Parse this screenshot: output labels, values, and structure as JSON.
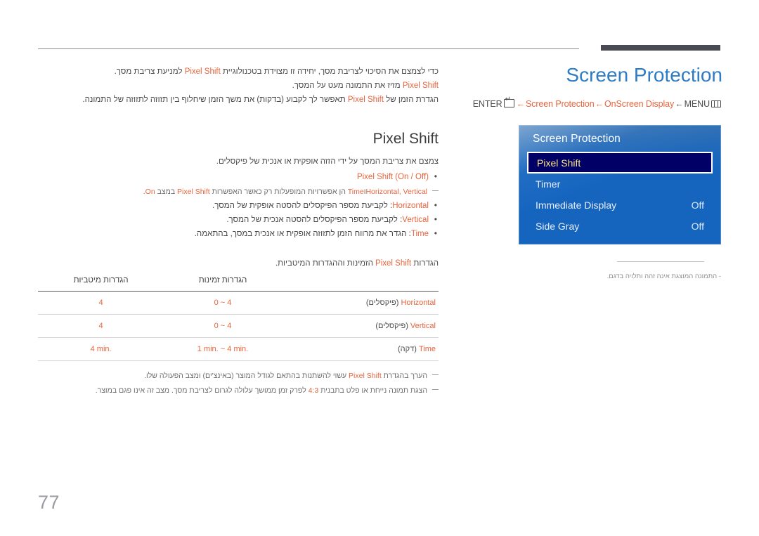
{
  "page": {
    "number": "77",
    "language": "he"
  },
  "header": {
    "title": "Screen Protection",
    "title_color": "#2d7cc4",
    "accent_color": "#e8643c"
  },
  "breadcrumb": {
    "enter_label": "ENTER",
    "enter_icon": "enter-key-icon",
    "arrow": "←",
    "items": [
      {
        "label": "Screen Protection",
        "accent": true
      },
      {
        "label": "OnScreen Display",
        "accent": true
      },
      {
        "label": "MENU",
        "accent": false
      }
    ],
    "menu_icon": "menu-key-icon"
  },
  "osd": {
    "title": "Screen Protection",
    "rows": [
      {
        "label": "Pixel Shift",
        "value": "",
        "selected": true
      },
      {
        "label": "Timer",
        "value": "",
        "selected": false
      },
      {
        "label": "Immediate Display",
        "value": "Off",
        "selected": false
      },
      {
        "label": "Side Gray",
        "value": "Off",
        "selected": false
      }
    ],
    "selected_bg": "#000066",
    "selected_text": "#ffe680",
    "panel_blue": "#1565bf"
  },
  "osd_note": {
    "dash": "-",
    "text": "התמונה המוצגת אינה זהה ותלויה בדגם."
  },
  "intro": {
    "line1_a": "כדי לצמצם את הסיכוי לצריבת מסך, יחידה זו מצוידת בטכנולוגיית ",
    "line1_hl": "Pixel Shift",
    "line1_b": " למניעת צריבת מסך.",
    "line2_hl": "Pixel Shift",
    "line2_b": " מזיז את התמונה מעט על המסך.",
    "line3_a": "הגדרת הזמן של ",
    "line3_hl": "Pixel Shift",
    "line3_b": " תאפשר לך לקבוע (בדקות) את משך הזמן שיחלוף בין תזוזה לתזוזה של התמונה."
  },
  "section": {
    "title": "Pixel Shift",
    "lead": "צמצם את צריבת המסך על ידי הזזה אופקית או אנכית של פיקסלים.",
    "bullets": [
      {
        "hl": "Pixel Shift (On / Off)",
        "rest": ""
      },
      {
        "hl": "Horizontal",
        "rest": ": לקביעת מספר הפיקסלים להסטה אופקית של המסך."
      },
      {
        "hl": "Vertical",
        "rest": ": לקביעת מספר הפיקסלים להסטה אנכית של המסך."
      },
      {
        "hl": "Time",
        "rest": ": הגדר את מרווח הזמן לתזוזה אופקית או אנכית במסך, בהתאמה."
      }
    ],
    "note_after_first_bullet": {
      "hl1": "Horizontal, Vertical",
      "and": "ו",
      "hl2": "Time",
      "mid": " הן אפשרויות המופעלות רק כאשר האפשרות ",
      "hl3": "Pixel Shift",
      "mid2": " במצב ",
      "hl4": "On",
      "end": "."
    }
  },
  "table": {
    "caption_a": "הגדרות ",
    "caption_hl": "Pixel Shift",
    "caption_b": " הזמינות וההגדרות המיטביות.",
    "columns": [
      "",
      "הגדרות זמינות",
      "הגדרות מיטביות"
    ],
    "rows": [
      {
        "label_hl": "Horizontal",
        "label_unit": " (פיקסלים)",
        "available": "0 ~ 4",
        "optimized": "4"
      },
      {
        "label_hl": "Vertical",
        "label_unit": " (פיקסלים)",
        "available": "0 ~ 4",
        "optimized": "4"
      },
      {
        "label_hl": "Time",
        "label_unit": " (דקה)",
        "available": "1 min. ~ 4 min.",
        "optimized": "4 min."
      }
    ]
  },
  "footnotes": [
    {
      "a": "הערך בהגדרת ",
      "hl": "Pixel Shift",
      "b": " עשוי להשתנות בהתאם לגודל המוצר (באינצ'ים) ומצב הפעולה שלו."
    },
    {
      "a": "הצגת תמונה נייחת או פלט בתבנית ",
      "hl": "4:3",
      "b": " לפרק זמן ממושך עלולה לגרום לצריבת מסך. מצב זה אינו פגם במוצר."
    }
  ]
}
